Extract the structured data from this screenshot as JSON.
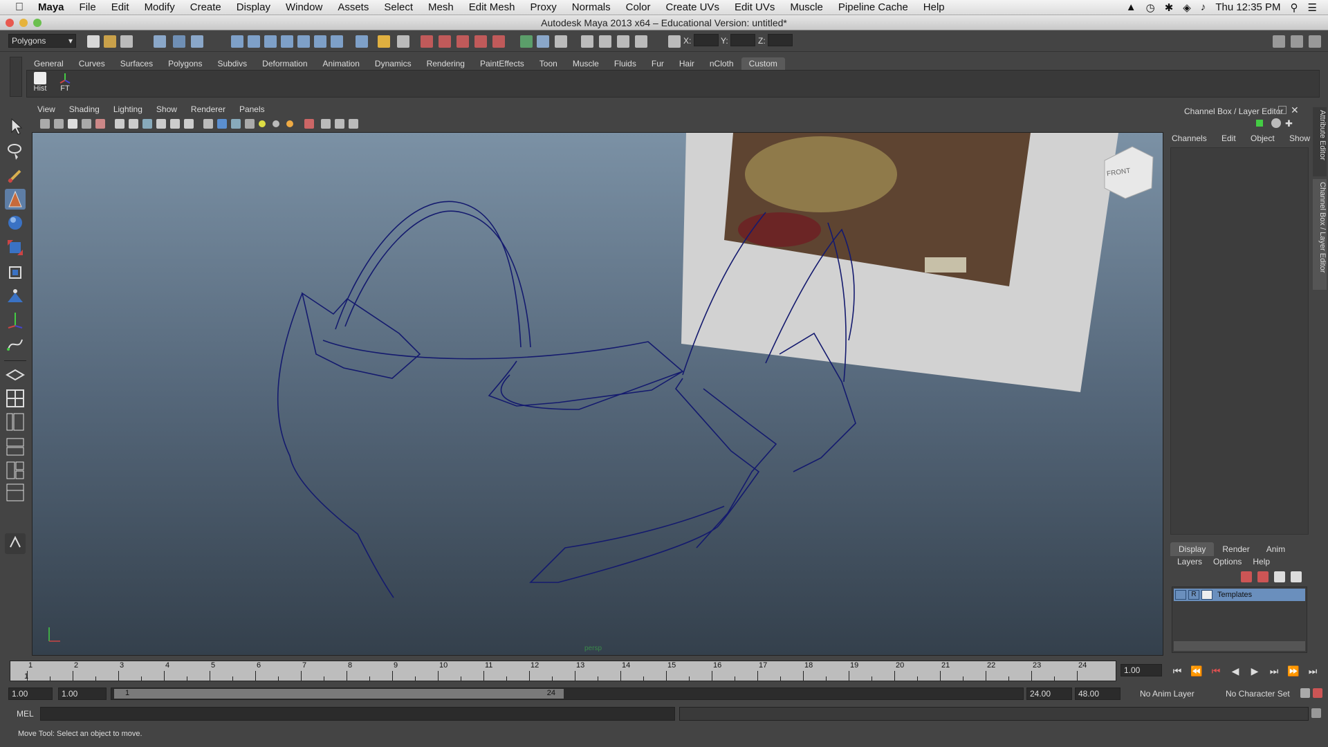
{
  "menubar": {
    "app_name": "Maya",
    "items": [
      "File",
      "Edit",
      "Modify",
      "Create",
      "Display",
      "Window",
      "Assets",
      "Select",
      "Mesh",
      "Edit Mesh",
      "Proxy",
      "Normals",
      "Color",
      "Create UVs",
      "Edit UVs",
      "Muscle",
      "Pipeline Cache",
      "Help"
    ],
    "clock": "Thu 12:35 PM"
  },
  "window": {
    "title": "Autodesk Maya 2013 x64 – Educational Version: untitled*"
  },
  "statusline": {
    "mode_menu": "Polygons",
    "x_label": "X:",
    "y_label": "Y:",
    "z_label": "Z:"
  },
  "shelf": {
    "tabs": [
      "General",
      "Curves",
      "Surfaces",
      "Polygons",
      "Subdivs",
      "Deformation",
      "Animation",
      "Dynamics",
      "Rendering",
      "PaintEffects",
      "Toon",
      "Muscle",
      "Fluids",
      "Fur",
      "Hair",
      "nCloth",
      "Custom"
    ],
    "active_tab": "Custom",
    "buttons": [
      "Hist",
      "FT"
    ]
  },
  "panel": {
    "menu": [
      "View",
      "Shading",
      "Lighting",
      "Show",
      "Renderer",
      "Panels"
    ],
    "camera_label": "persp",
    "viewcube_label": "FRONT"
  },
  "channelbox": {
    "header": "Channel Box / Layer Editor",
    "menu": [
      "Channels",
      "Edit",
      "Object",
      "Show"
    ],
    "side_tabs": [
      "Attribute Editor",
      "Channel Box / Layer Editor"
    ]
  },
  "layers": {
    "tabs": [
      "Display",
      "Render",
      "Anim"
    ],
    "active_tab": "Display",
    "menu": [
      "Layers",
      "Options",
      "Help"
    ],
    "rows": [
      {
        "visible": "",
        "type": "R",
        "name": "Templates"
      }
    ]
  },
  "timeline": {
    "ticks": [
      "1",
      "2",
      "3",
      "4",
      "5",
      "6",
      "7",
      "8",
      "9",
      "10",
      "11",
      "12",
      "13",
      "14",
      "15",
      "16",
      "17",
      "18",
      "19",
      "20",
      "21",
      "22",
      "23",
      "24"
    ],
    "current_frame": "1.00",
    "current_marker": "1"
  },
  "range": {
    "start_time": "1.00",
    "playback_start": "1.00",
    "range_start": "1",
    "range_end": "24",
    "playback_end": "24.00",
    "end_time": "48.00",
    "anim_layer": "No Anim Layer",
    "character_set": "No Character Set"
  },
  "command": {
    "label": "MEL"
  },
  "help": {
    "text": "Move Tool: Select an object to move."
  },
  "colors": {
    "wire": "#141a6e",
    "viewport_top": "#7b91a5",
    "viewport_bottom": "#34404c",
    "layer_highlight": "#6a8fbd"
  }
}
